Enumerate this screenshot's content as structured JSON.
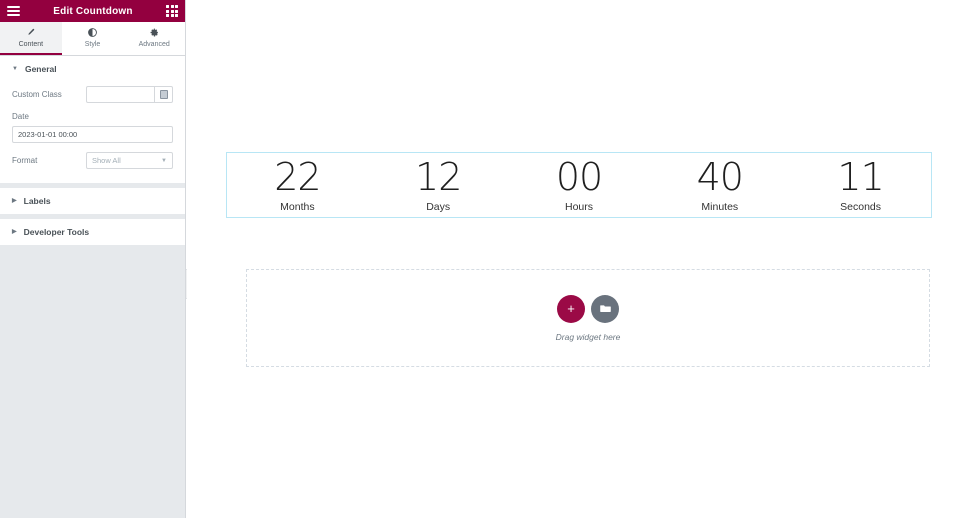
{
  "panel": {
    "header": {
      "title": "Edit Countdown",
      "menu_icon": "hamburger-icon",
      "apps_icon": "grid-apps-icon"
    },
    "tabs": [
      {
        "label": "Content",
        "icon": "pencil-icon",
        "active": true
      },
      {
        "label": "Style",
        "icon": "contrast-half-circle-icon",
        "active": false
      },
      {
        "label": "Advanced",
        "icon": "gear-icon",
        "active": false
      }
    ],
    "sections": [
      {
        "title": "General",
        "expanded": true,
        "fields": {
          "custom_class": {
            "label": "Custom Class",
            "value": "",
            "placeholder": "",
            "addon_icon": "dynamic-tags-icon"
          },
          "date": {
            "label": "Date",
            "value": "2023-01-01 00:00"
          },
          "format": {
            "label": "Format",
            "value": "Show All",
            "options": [
              "Show All"
            ]
          }
        }
      },
      {
        "title": "Labels",
        "expanded": false
      },
      {
        "title": "Developer Tools",
        "expanded": false
      }
    ],
    "collapse_handle": "‹"
  },
  "canvas": {
    "countdown": {
      "items": [
        {
          "digits": "22",
          "label": "Months"
        },
        {
          "digits": "12",
          "label": "Days"
        },
        {
          "digits": "00",
          "label": "Hours"
        },
        {
          "digits": "40",
          "label": "Minutes"
        },
        {
          "digits": "11",
          "label": "Seconds"
        }
      ]
    },
    "drop_zone": {
      "text": "Drag widget here",
      "add_button_glyph": "+",
      "folder_button_icon": "folder-icon"
    }
  },
  "colors": {
    "brand": "#93003f",
    "accent_add": "#9b0a46",
    "panel_bg": "#e6e9ec",
    "selection_border": "#b8e6f5",
    "folder_button": "#69727d"
  }
}
